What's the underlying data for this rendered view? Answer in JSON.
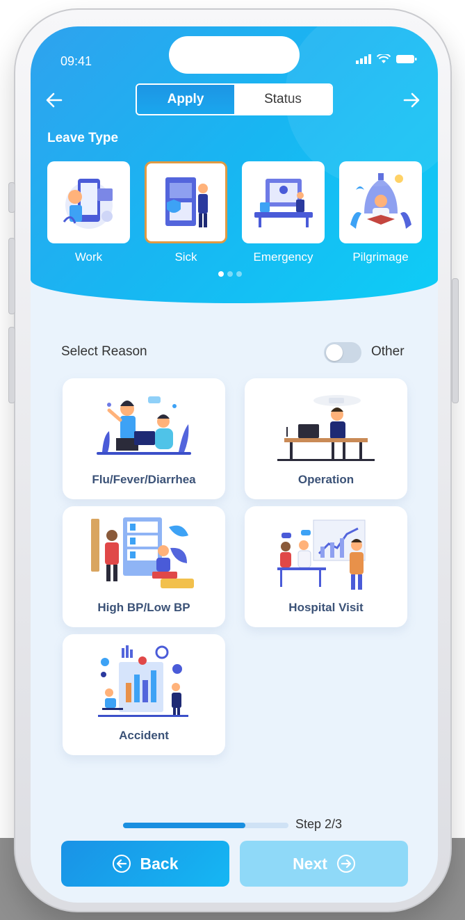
{
  "status_bar": {
    "time": "09:41"
  },
  "tabs": [
    {
      "label": "Apply",
      "active": true
    },
    {
      "label": "Status",
      "active": false
    }
  ],
  "leave_type": {
    "title": "Leave Type",
    "items": [
      {
        "label": "Work",
        "selected": false,
        "icon": "work-illustration"
      },
      {
        "label": "Sick",
        "selected": true,
        "icon": "sick-illustration"
      },
      {
        "label": "Emergency",
        "selected": false,
        "icon": "emergency-illustration"
      },
      {
        "label": "Pilgrimage",
        "selected": false,
        "icon": "pilgrimage-illustration"
      }
    ],
    "page_dots": {
      "count": 3,
      "active": 0
    }
  },
  "reason": {
    "title": "Select Reason",
    "other_label": "Other",
    "other_enabled": false,
    "items": [
      {
        "label": "Flu/Fever/Diarrhea"
      },
      {
        "label": "Operation"
      },
      {
        "label": "High BP/Low BP"
      },
      {
        "label": "Hospital Visit"
      },
      {
        "label": "Accident"
      }
    ]
  },
  "progress": {
    "label": "Step 2/3",
    "fraction": 0.74
  },
  "buttons": {
    "back": "Back",
    "next": "Next"
  },
  "colors": {
    "accent": "#1a92e6",
    "header_end": "#0ecdf6",
    "selected_border": "#e09a43",
    "next_disabled": "#8fd9f8"
  }
}
